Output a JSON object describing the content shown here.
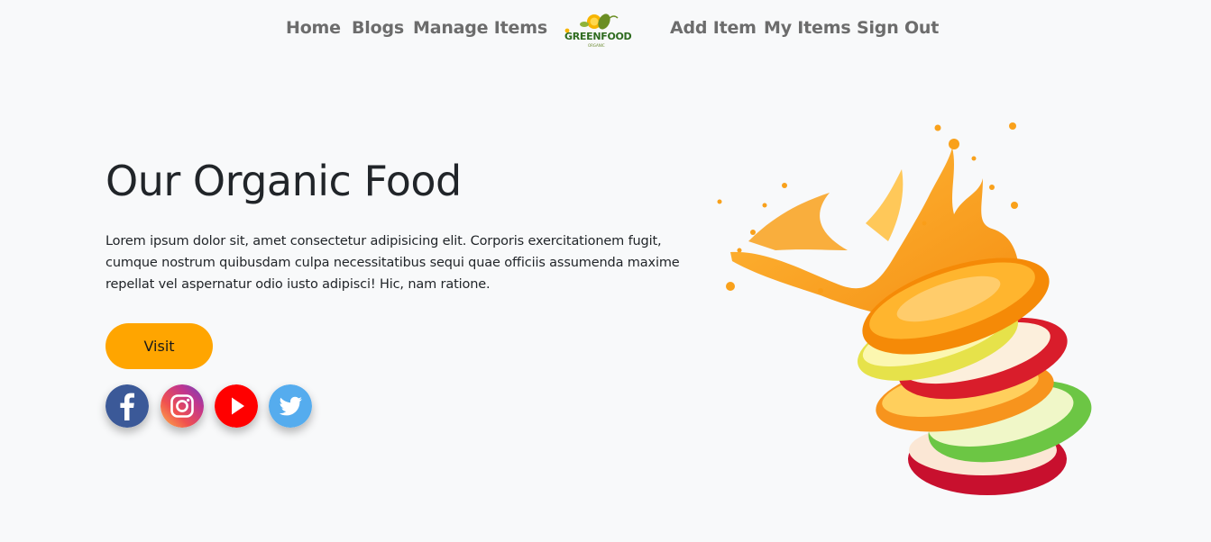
{
  "nav": {
    "left_links": [
      "Home",
      "Blogs",
      "Manage Items"
    ],
    "right_links": [
      "Add Item",
      "My Items",
      "Sign Out"
    ],
    "logo": {
      "text": "GREENFOOD",
      "subtext": "ORGANIC"
    }
  },
  "hero": {
    "title": "Our Organic Food",
    "description": "Lorem ipsum dolor sit, amet consectetur adipisicing elit. Corporis exercitationem fugit, cumque nostrum quibusdam culpa necessitatibus sequi quae officiis assumenda maxime repellat vel aspernatur odio iusto adipisci! Hic, nam ratione.",
    "button_label": "Visit"
  },
  "social": [
    {
      "name": "facebook",
      "icon": "facebook-icon",
      "color": "#3b5998"
    },
    {
      "name": "instagram",
      "icon": "instagram-icon",
      "color": "#c13584"
    },
    {
      "name": "youtube",
      "icon": "youtube-icon",
      "color": "#ff0000"
    },
    {
      "name": "twitter",
      "icon": "twitter-icon",
      "color": "#55acee"
    }
  ],
  "colors": {
    "accent": "#ffa500",
    "background": "#f8f9fa",
    "nav_text": "#6c6c6c",
    "brand_green": "#2e6b1f"
  }
}
